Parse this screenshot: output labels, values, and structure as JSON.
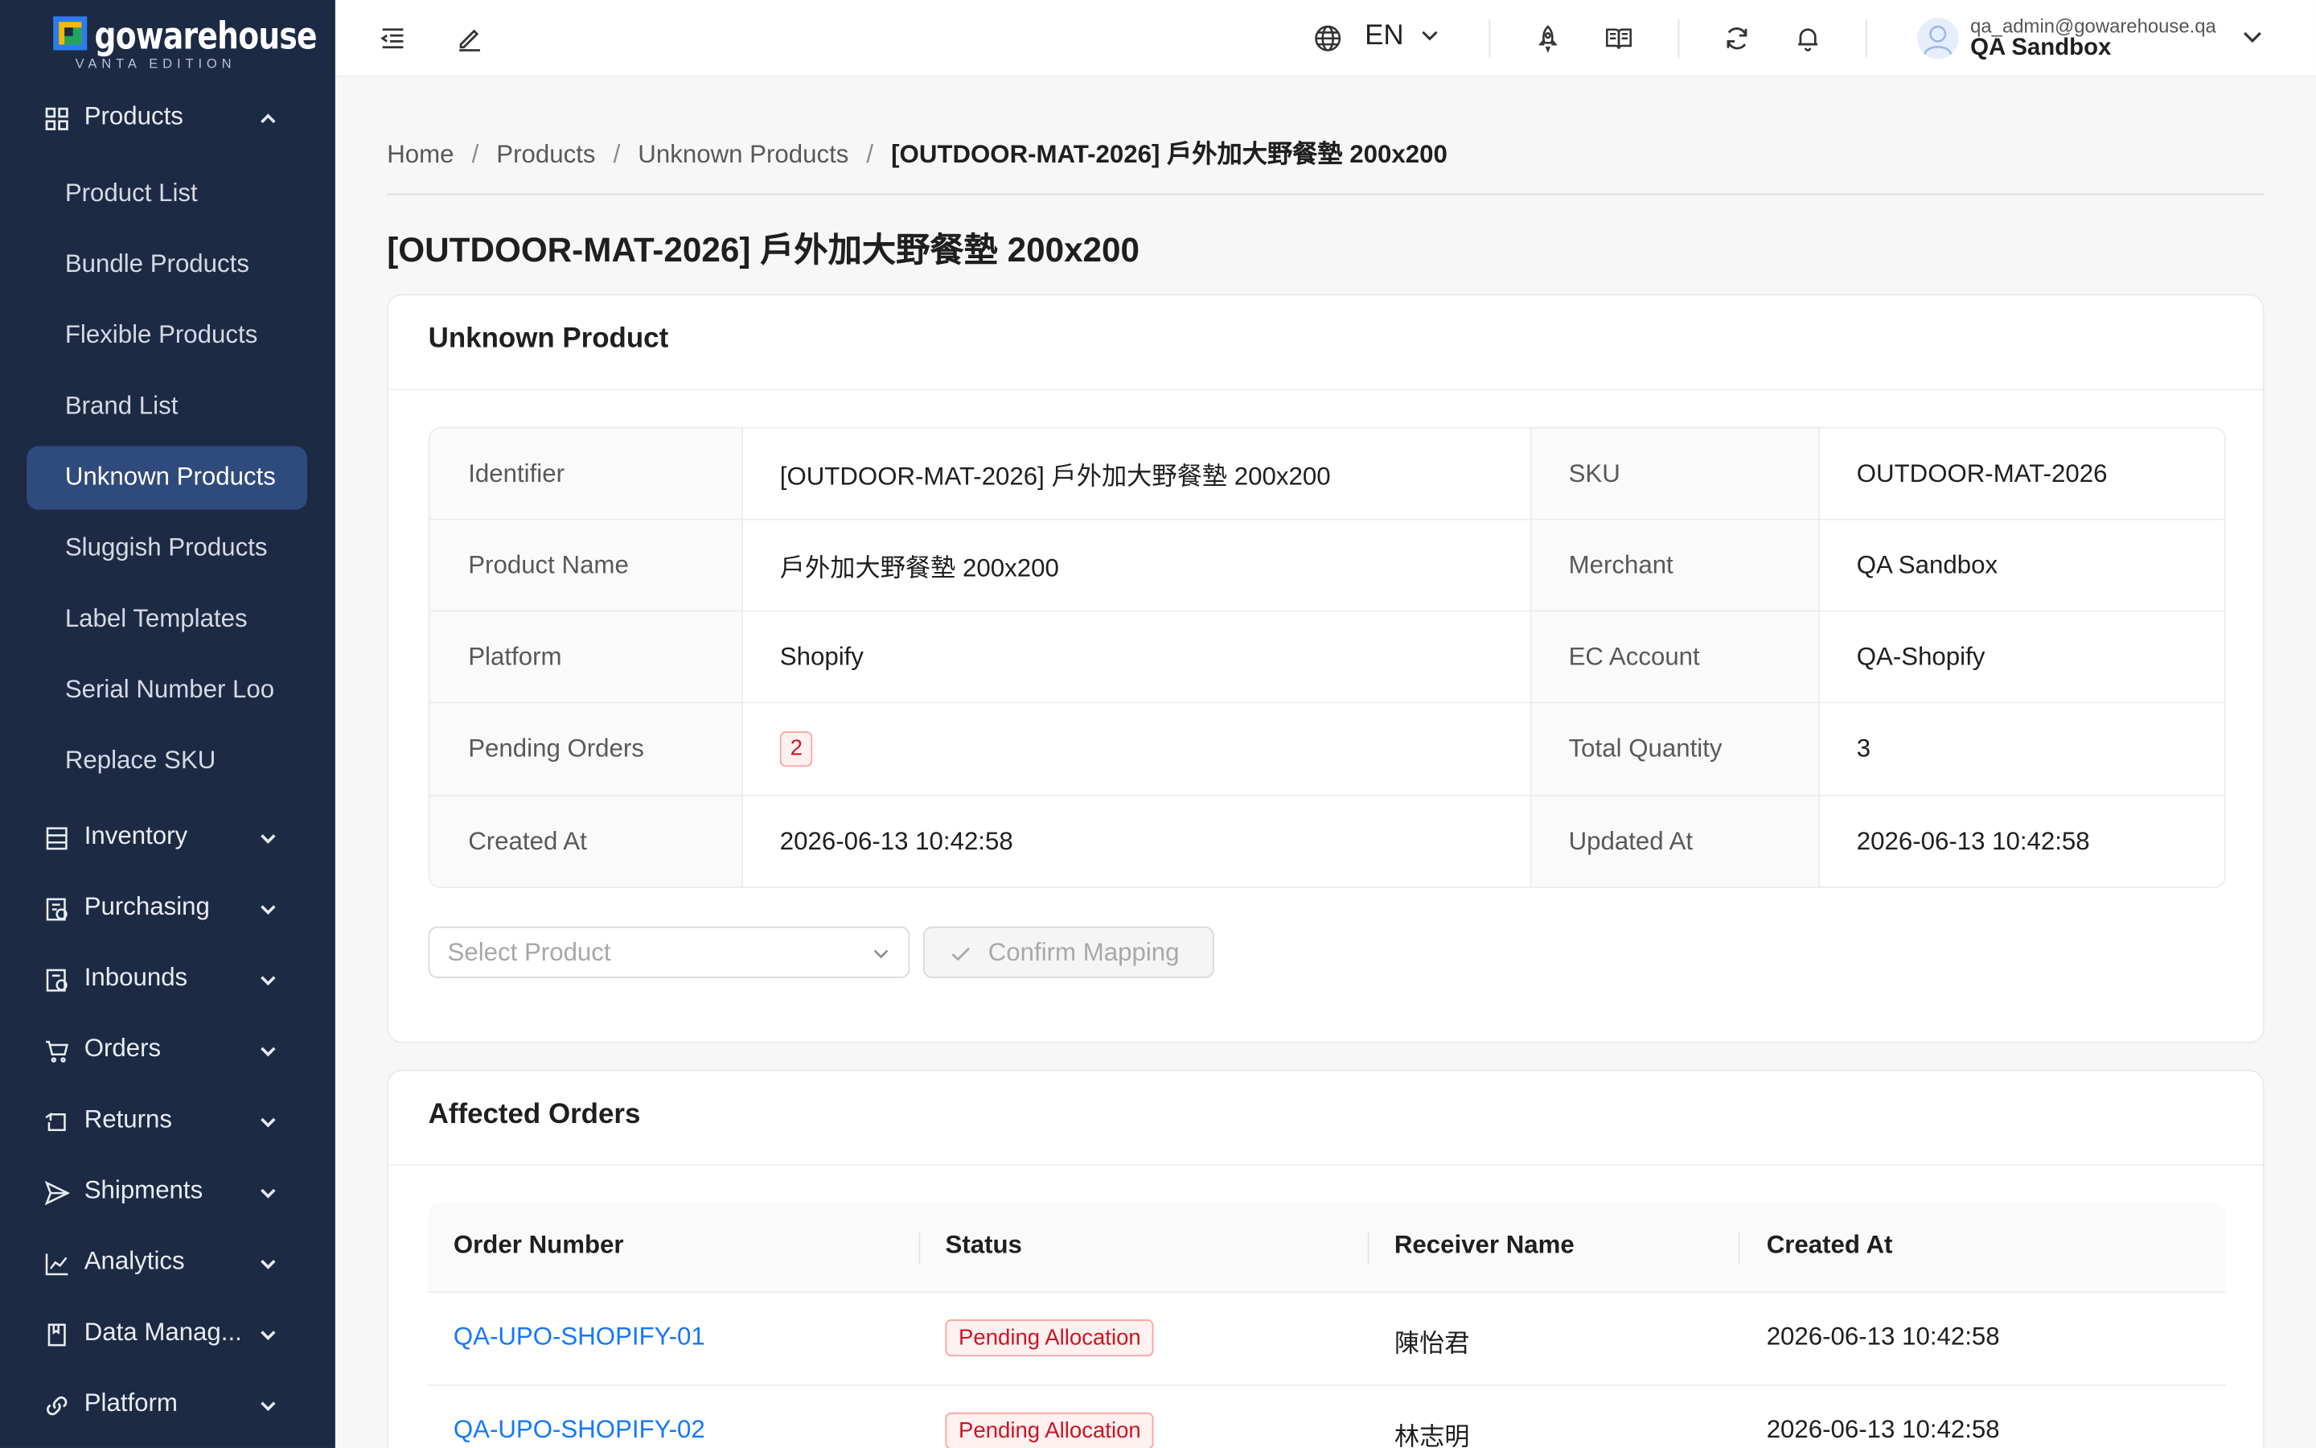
{
  "app": {
    "brand": "gowarehouse",
    "edition": "VANTA EDITION"
  },
  "sidebar": {
    "products_group": "Products",
    "items": [
      {
        "label": "Product List"
      },
      {
        "label": "Bundle Products"
      },
      {
        "label": "Flexible Products"
      },
      {
        "label": "Brand List"
      },
      {
        "label": "Unknown Products"
      },
      {
        "label": "Sluggish Products"
      },
      {
        "label": "Label Templates"
      },
      {
        "label": "Serial Number Loo"
      },
      {
        "label": "Replace SKU"
      }
    ],
    "groups": [
      {
        "label": "Inventory"
      },
      {
        "label": "Purchasing"
      },
      {
        "label": "Inbounds"
      },
      {
        "label": "Orders"
      },
      {
        "label": "Returns"
      },
      {
        "label": "Shipments"
      },
      {
        "label": "Analytics"
      },
      {
        "label": "Data Manag..."
      },
      {
        "label": "Platform"
      }
    ]
  },
  "header": {
    "language": "EN",
    "user_email": "qa_admin@gowarehouse.qa",
    "user_org": "QA Sandbox"
  },
  "breadcrumb": {
    "items": [
      "Home",
      "Products",
      "Unknown Products"
    ],
    "current": "[OUTDOOR-MAT-2026] 戶外加大野餐墊 200x200"
  },
  "page": {
    "title": "[OUTDOOR-MAT-2026] 戶外加大野餐墊 200x200"
  },
  "unknown_product": {
    "card_title": "Unknown Product",
    "rows": [
      {
        "l1": "Identifier",
        "v1": "[OUTDOOR-MAT-2026] 戶外加大野餐墊 200x200",
        "l2": "SKU",
        "v2": "OUTDOOR-MAT-2026"
      },
      {
        "l1": "Product Name",
        "v1": "戶外加大野餐墊 200x200",
        "l2": "Merchant",
        "v2": "QA Sandbox"
      },
      {
        "l1": "Platform",
        "v1": "Shopify",
        "l2": "EC Account",
        "v2": "QA-Shopify"
      },
      {
        "l1": "Pending Orders",
        "v1": "2",
        "l2": "Total Quantity",
        "v2": "3"
      },
      {
        "l1": "Created At",
        "v1": "2026-06-13 10:42:58",
        "l2": "Updated At",
        "v2": "2026-06-13 10:42:58"
      }
    ],
    "select_placeholder": "Select Product",
    "confirm_label": "Confirm Mapping"
  },
  "affected_orders": {
    "card_title": "Affected Orders",
    "columns": [
      "Order Number",
      "Status",
      "Receiver Name",
      "Created At"
    ],
    "rows": [
      {
        "order": "QA-UPO-SHOPIFY-01",
        "status": "Pending Allocation",
        "receiver": "陳怡君",
        "created": "2026-06-13 10:42:58"
      },
      {
        "order": "QA-UPO-SHOPIFY-02",
        "status": "Pending Allocation",
        "receiver": "林志明",
        "created": "2026-06-13 10:42:58"
      }
    ]
  },
  "colors": {
    "sidebar_bg": "#1d2a44",
    "active_item": "#2f4a7c",
    "link": "#1677ff",
    "danger": "#cf1322"
  }
}
